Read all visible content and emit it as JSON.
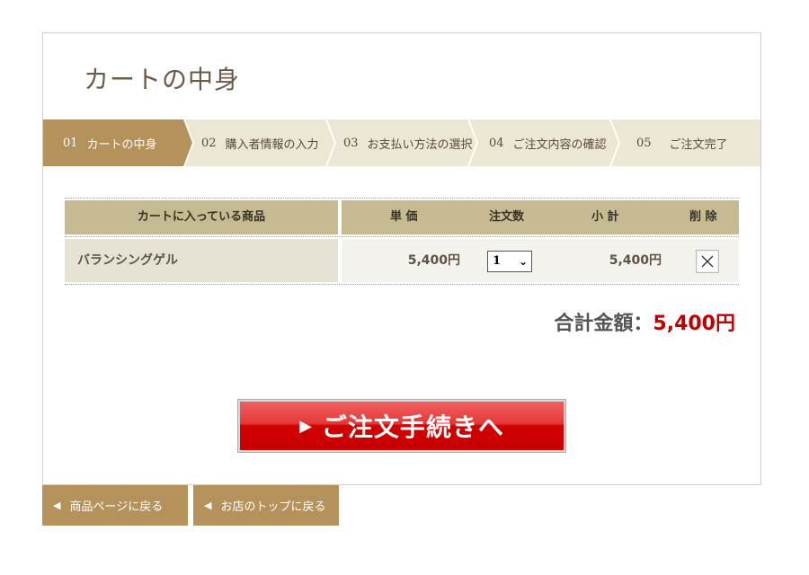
{
  "page_title": "カートの中身",
  "steps": [
    {
      "num": "01",
      "label": "カートの中身"
    },
    {
      "num": "02",
      "label": "購入者情報の入力"
    },
    {
      "num": "03",
      "label": "お支払い方法の選択"
    },
    {
      "num": "04",
      "label": "ご注文内容の確認"
    },
    {
      "num": "05",
      "label": "ご注文完了"
    }
  ],
  "table": {
    "headers": {
      "item": "カートに入っている商品",
      "unit_price": "単 価",
      "qty": "注文数",
      "subtotal": "小 計",
      "delete": "削 除"
    },
    "rows": [
      {
        "name": "バランシングゲル",
        "unit_price": "5,400円",
        "qty": "1",
        "subtotal": "5,400円"
      }
    ]
  },
  "total": {
    "label": "合計金額：",
    "amount": "5,400円"
  },
  "order_button": {
    "label": "ご注文手続きへ"
  },
  "nav": {
    "back_to_product": "商品ページに戻る",
    "back_to_top": "お店のトップに戻る"
  },
  "colors": {
    "accent": "#b5925c",
    "step_bg": "#ece6d4",
    "total_red": "#c00000",
    "button_red": "#d00000"
  }
}
